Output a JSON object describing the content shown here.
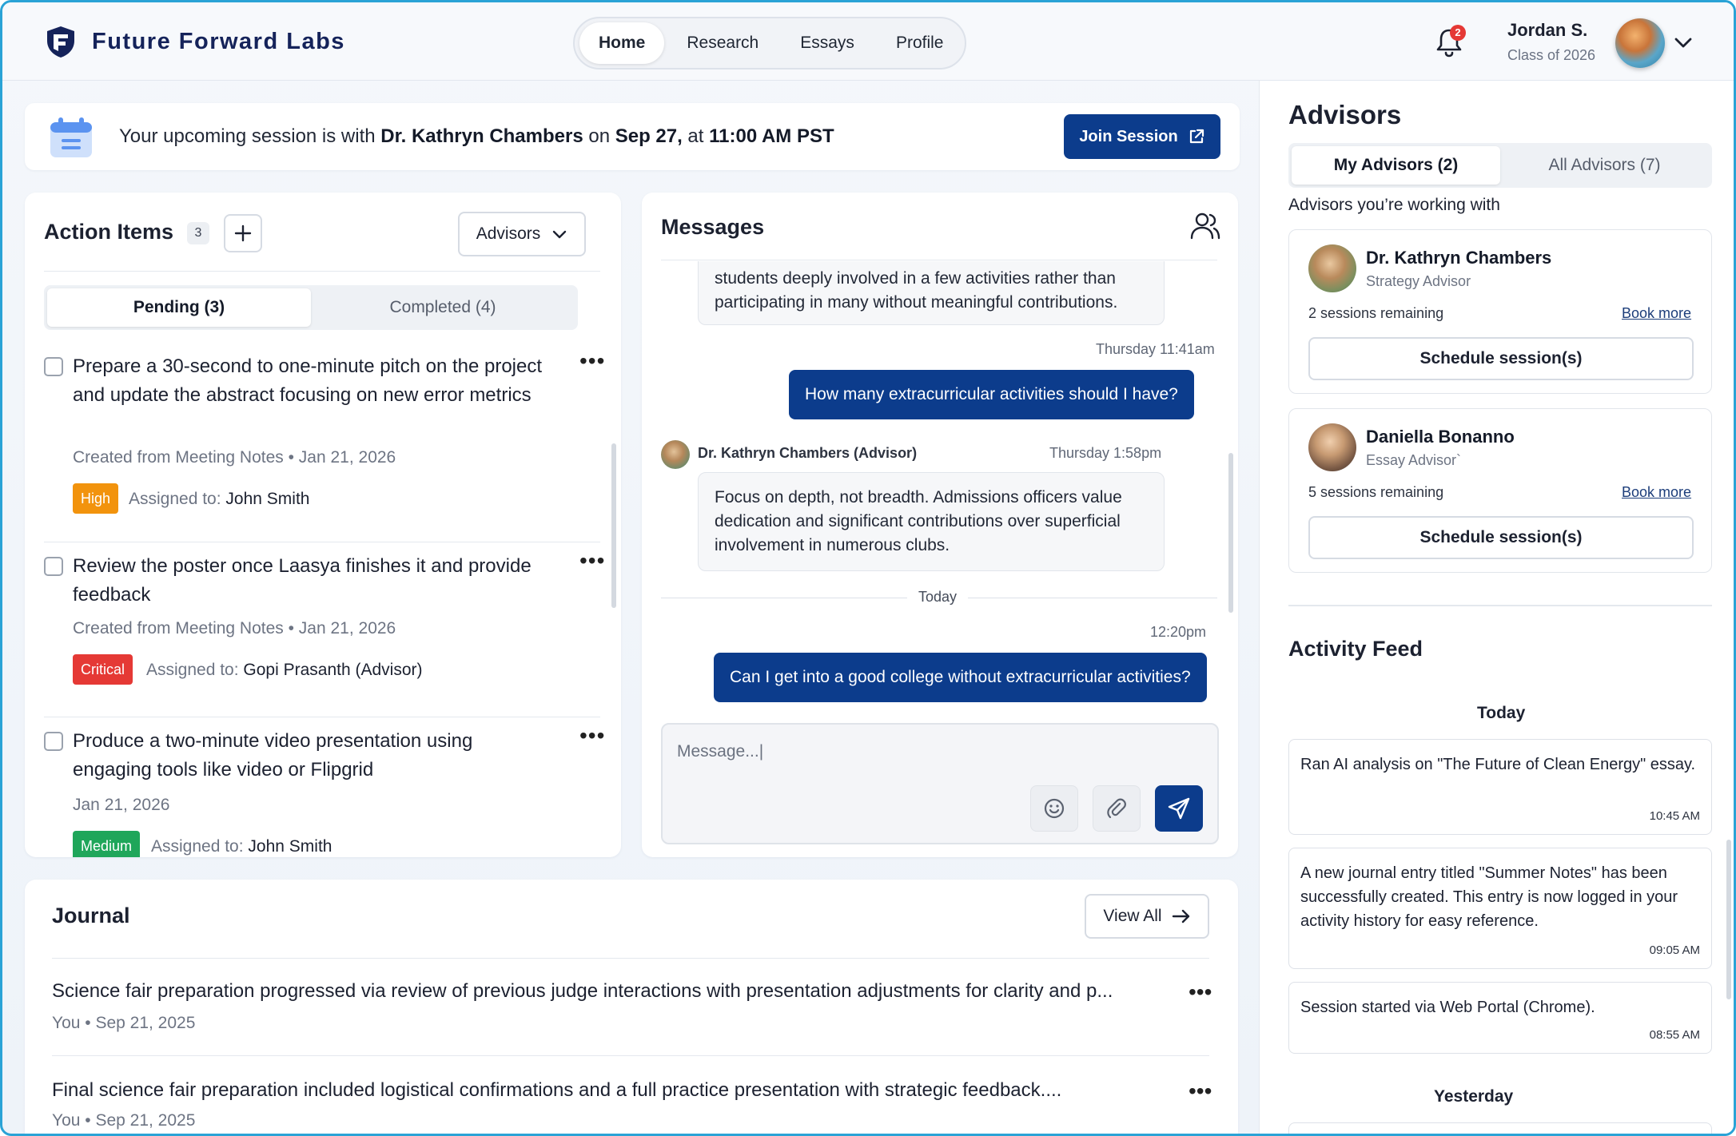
{
  "header": {
    "brand": "Future Forward Labs",
    "nav": [
      {
        "label": "Home",
        "active": true
      },
      {
        "label": "Research",
        "active": false
      },
      {
        "label": "Essays",
        "active": false
      },
      {
        "label": "Profile",
        "active": false
      }
    ],
    "notifications_count": "2",
    "user": {
      "name": "Jordan S.",
      "subtitle": "Class of 2026"
    }
  },
  "banner": {
    "prefix": "Your upcoming session is with ",
    "advisor": "Dr. Kathryn Chambers",
    "middle": " on ",
    "date": "Sep 27,",
    "at": " at ",
    "time": "11:00 AM PST",
    "button": "Join Session"
  },
  "action_items": {
    "title": "Action Items",
    "count": "3",
    "filter_label": "Advisors",
    "tabs": [
      {
        "label": "Pending (3)",
        "active": true
      },
      {
        "label": "Completed (4)",
        "active": false
      }
    ],
    "items": [
      {
        "text": "Prepare a 30-second to one-minute pitch on the project and update the abstract focusing on new error metrics",
        "meta": "Created from Meeting Notes  •  Jan 21, 2026",
        "priority": "High",
        "priority_color": "#f2930d",
        "assigned_label": "Assigned to:",
        "assignee": "John Smith"
      },
      {
        "text": "Review the poster once Laasya finishes it and provide feedback",
        "meta": "Created from Meeting Notes  •  Jan 21, 2026",
        "priority": "Critical",
        "priority_color": "#e53935",
        "assigned_label": "Assigned to:",
        "assignee": "Gopi Prasanth (Advisor)"
      },
      {
        "text": "Produce a two-minute video presentation using engaging tools like video or Flipgrid",
        "meta": "Jan 21, 2026",
        "priority": "Medium",
        "priority_color": "#1fa65a",
        "assigned_label": "Assigned to:",
        "assignee": "John Smith"
      }
    ]
  },
  "messages": {
    "title": "Messages",
    "thread": {
      "partial_in": "students deeply involved in a few activities rather than participating in many without meaningful contributions.",
      "time1": "Thursday 11:41am",
      "out1": "How many extracurricular activities should I have?",
      "sender": "Dr. Kathryn Chambers (Advisor)",
      "time2": "Thursday 1:58pm",
      "in1": "Focus on depth, not breadth. Admissions officers value dedication and significant contributions over superficial involvement in numerous clubs.",
      "day": "Today",
      "time3": "12:20pm",
      "out2": "Can I get into a good college without extracurricular activities?"
    },
    "composer_placeholder": "Message...|"
  },
  "journal": {
    "title": "Journal",
    "view_all": "View All",
    "entries": [
      {
        "text": "Science fair preparation progressed via review of previous judge interactions with presentation adjustments for clarity and p...",
        "meta": "You • Sep 21, 2025"
      },
      {
        "text": "Final science fair preparation included logistical confirmations and a full practice presentation with strategic feedback....",
        "meta": "You • Sep 21, 2025"
      }
    ]
  },
  "advisors": {
    "title": "Advisors",
    "tabs": [
      {
        "label": "My Advisors (2)",
        "active": true
      },
      {
        "label": "All Advisors (7)",
        "active": false
      }
    ],
    "subtitle": "Advisors you’re working with",
    "list": [
      {
        "name": "Dr. Kathryn Chambers",
        "role": "Strategy Advisor",
        "sessions": "2 sessions remaining",
        "book": "Book more",
        "schedule": "Schedule session(s)"
      },
      {
        "name": "Daniella Bonanno",
        "role": "Essay Advisor`",
        "sessions": "5 sessions remaining",
        "book": "Book more",
        "schedule": "Schedule session(s)"
      }
    ]
  },
  "activity_feed": {
    "title": "Activity Feed",
    "today_label": "Today",
    "items": [
      {
        "text": "Ran AI analysis on \"The Future of Clean Energy\" essay.",
        "time": "10:45 AM"
      },
      {
        "text": "A new journal entry titled \"Summer Notes\" has been successfully created. This entry is now logged in your activity history for easy reference.",
        "time": "09:05 AM"
      },
      {
        "text": "Session started via Web Portal (Chrome).",
        "time": "08:55 AM"
      }
    ],
    "yesterday_label": "Yesterday"
  },
  "colors": {
    "primary": "#0c3c8c",
    "frame": "#2aa3d6",
    "high": "#f2930d",
    "critical": "#e53935",
    "medium": "#1fa65a"
  }
}
